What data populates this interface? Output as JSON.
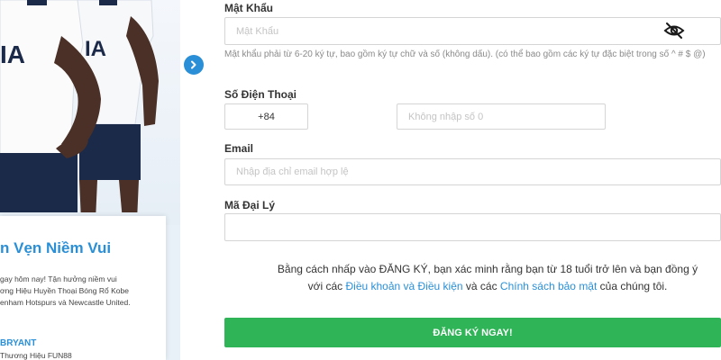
{
  "promo": {
    "title": "n Vẹn Niềm Vui",
    "body_lines": [
      "gay hôm nay! Tận hưởng niềm vui",
      "ơng Hiệu Huyền Thoại Bóng Rổ Kobe",
      "enham Hotspurs và Newcastle United."
    ],
    "author": "BRYANT",
    "author_role": "Thương Hiệu FUN88",
    "jersey_text": "IA"
  },
  "form": {
    "password": {
      "label": "Mật Khẩu",
      "placeholder": "Mật Khẩu",
      "hint": "Mật khẩu phải từ 6-20 ký tự, bao gồm ký tự chữ và số (không dấu). (có thể bao gồm các ký tự đặc biệt trong số ^ # $ @)",
      "toggle_icon": "eye-slash-icon"
    },
    "phone": {
      "label": "Số Điện Thoại",
      "country_code": "+84",
      "placeholder": "Không nhập số 0"
    },
    "email": {
      "label": "Email",
      "placeholder": "Nhập địa chỉ email hợp lệ"
    },
    "agent": {
      "label": "Mã Đại Lý",
      "placeholder": ""
    },
    "terms": {
      "part1": "Bằng cách nhấp vào ĐĂNG KÝ, bạn xác minh rằng bạn từ 18 tuổi trở lên và bạn đồng ý với các ",
      "terms_link": "Điều khoản và Điều kiện",
      "part2": " và các ",
      "privacy_link": "Chính sách bảo mật",
      "part3": " của chúng tôi."
    },
    "submit_label": "ĐĂNG KÝ NGAY!"
  },
  "colors": {
    "accent_blue": "#2a8fd6",
    "submit_green": "#2fb457",
    "jersey_navy": "#1c2a4a"
  }
}
